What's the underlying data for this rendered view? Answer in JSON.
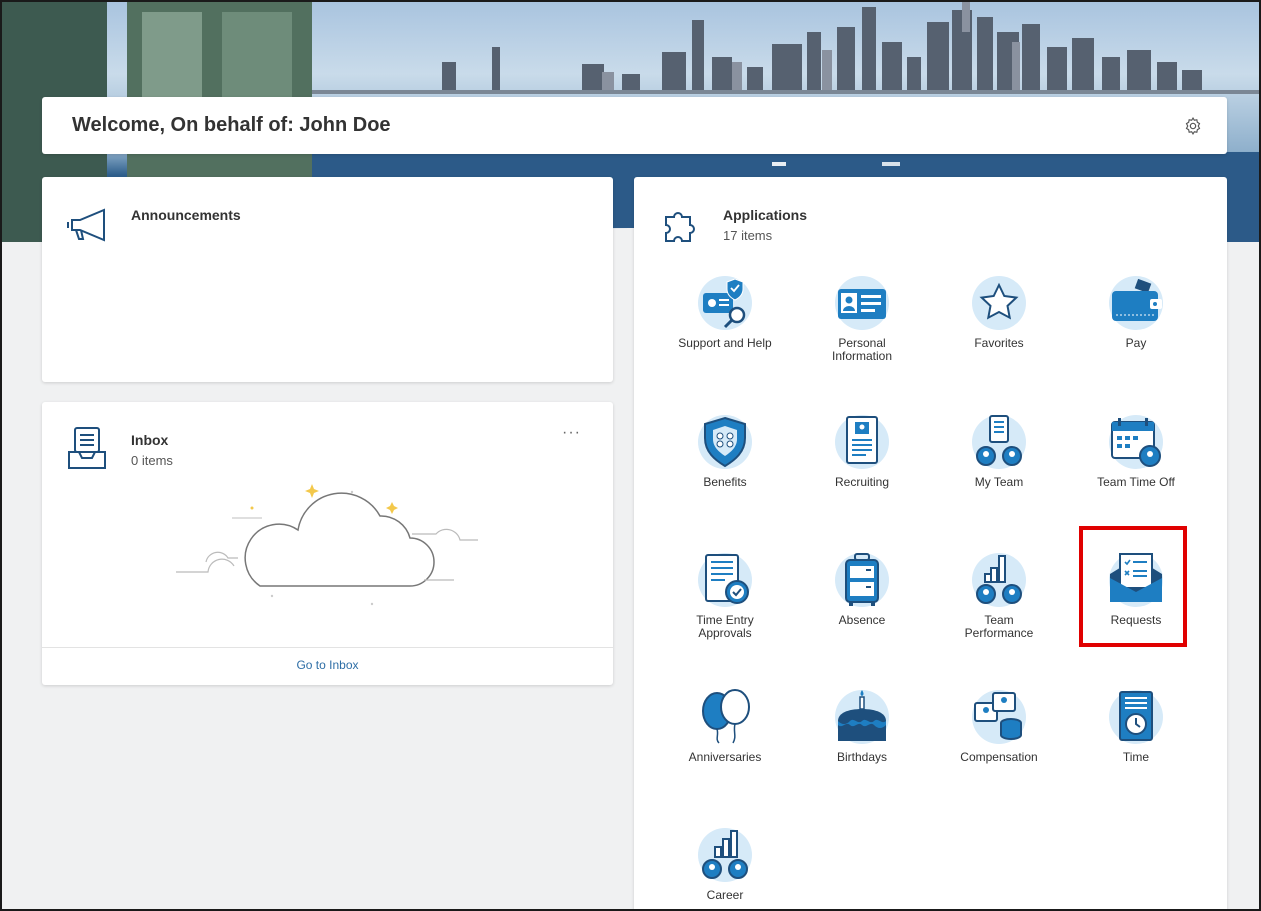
{
  "welcome": {
    "title": "Welcome, On behalf of: John Doe"
  },
  "announcements": {
    "title": "Announcements"
  },
  "inbox": {
    "title": "Inbox",
    "count": "0 items",
    "more": "···",
    "go_to_label": "Go to Inbox"
  },
  "applications": {
    "title": "Applications",
    "count": "17 items",
    "apps": [
      {
        "label": "Support and Help",
        "icon": "support-help-icon"
      },
      {
        "label": "Personal\nInformation",
        "icon": "personal-information-icon"
      },
      {
        "label": "Favorites",
        "icon": "star-icon"
      },
      {
        "label": "Pay",
        "icon": "wallet-icon"
      },
      {
        "label": "Benefits",
        "icon": "shield-icon"
      },
      {
        "label": "Recruiting",
        "icon": "resume-icon"
      },
      {
        "label": "My Team",
        "icon": "team-icon"
      },
      {
        "label": "Team Time Off",
        "icon": "calendar-icon"
      },
      {
        "label": "Time Entry\nApprovals",
        "icon": "time-approval-icon"
      },
      {
        "label": "Absence",
        "icon": "luggage-icon"
      },
      {
        "label": "Team\nPerformance",
        "icon": "performance-icon"
      },
      {
        "label": "Requests",
        "icon": "envelope-icon"
      },
      {
        "label": "Anniversaries",
        "icon": "balloons-icon"
      },
      {
        "label": "Birthdays",
        "icon": "cake-icon"
      },
      {
        "label": "Compensation",
        "icon": "compensation-icon"
      },
      {
        "label": "Time",
        "icon": "clock-icon"
      },
      {
        "label": "Career",
        "icon": "career-icon"
      }
    ]
  },
  "colors": {
    "accent": "#2e6ea6",
    "icon_blue": "#1e7ec2",
    "icon_light": "#d6eaf8",
    "highlight": "#e00000"
  }
}
